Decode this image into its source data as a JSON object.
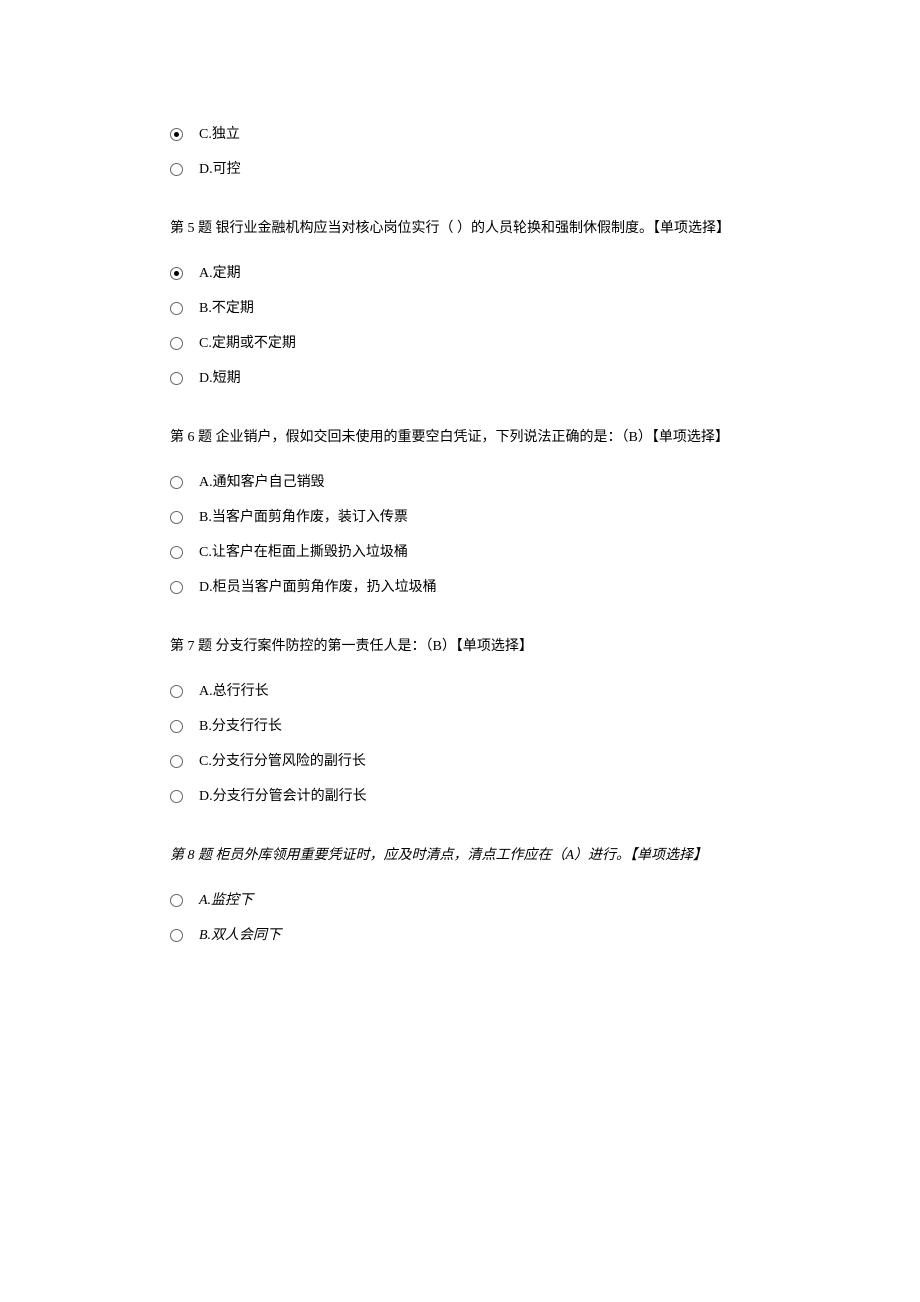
{
  "q4": {
    "options": [
      {
        "text": "C.独立",
        "selected": true
      },
      {
        "text": "D.可控",
        "selected": false
      }
    ]
  },
  "q5": {
    "text": "第 5 题  银行业金融机构应当对核心岗位实行（ ）的人员轮换和强制休假制度。【单项选择】",
    "options": [
      {
        "text": "A.定期",
        "selected": true
      },
      {
        "text": "B.不定期",
        "selected": false
      },
      {
        "text": "C.定期或不定期",
        "selected": false
      },
      {
        "text": "D.短期",
        "selected": false
      }
    ]
  },
  "q6": {
    "text": "第 6 题  企业销户，假如交回未使用的重要空白凭证，下列说法正确的是：（B）【单项选择】",
    "options": [
      {
        "text": "A.通知客户自己销毁",
        "selected": false
      },
      {
        "text": "B.当客户面剪角作废，装订入传票",
        "selected": false
      },
      {
        "text": "C.让客户在柜面上撕毁扔入垃圾桶",
        "selected": false
      },
      {
        "text": "D.柜员当客户面剪角作废，扔入垃圾桶",
        "selected": false
      }
    ]
  },
  "q7": {
    "text": "第 7 题  分支行案件防控的第一责任人是：（B）【单项选择】",
    "options": [
      {
        "text": "A.总行行长",
        "selected": false
      },
      {
        "text": "B.分支行行长",
        "selected": false
      },
      {
        "text": "C.分支行分管风险的副行长",
        "selected": false
      },
      {
        "text": "D.分支行分管会计的副行长",
        "selected": false
      }
    ]
  },
  "q8": {
    "text": "第 8 题 柜员外库领用重要凭证时，应及时清点，清点工作应在（A）进行。【单项选择】",
    "options": [
      {
        "text": "A.监控下",
        "selected": false
      },
      {
        "text": "B.双人会同下",
        "selected": false
      }
    ]
  }
}
